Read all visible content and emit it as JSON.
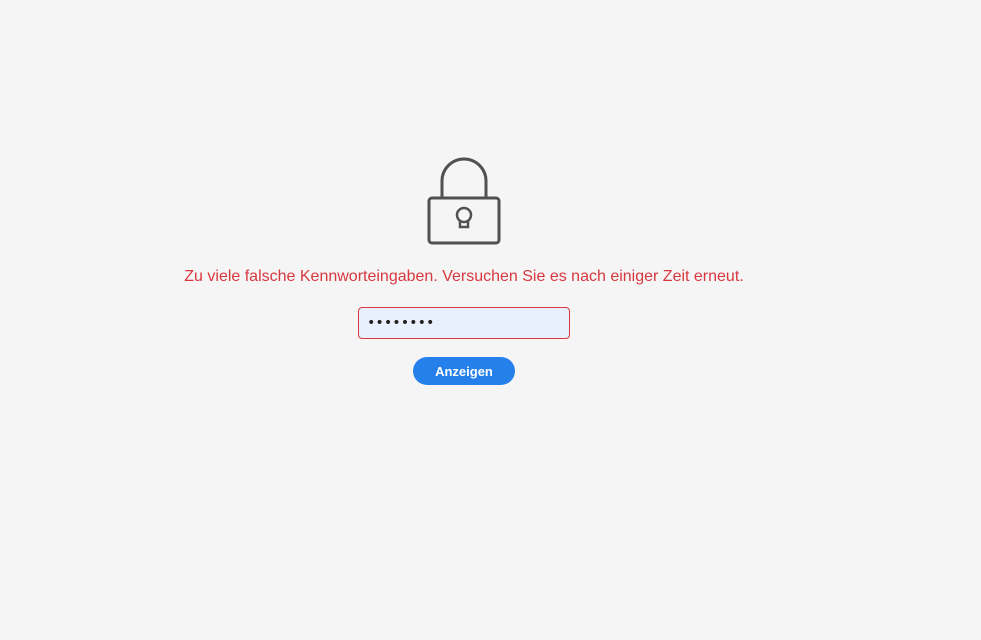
{
  "icon": "lock-icon",
  "error_message": "Zu viele falsche Kennworteingaben. Versuchen Sie es nach einiger Zeit erneut.",
  "password_field": {
    "value": "••••••••"
  },
  "show_button": {
    "label": "Anzeigen"
  },
  "colors": {
    "background": "#f5f5f5",
    "error": "#d7373f",
    "accent": "#2680eb",
    "input_bg": "#e8f0fe"
  }
}
